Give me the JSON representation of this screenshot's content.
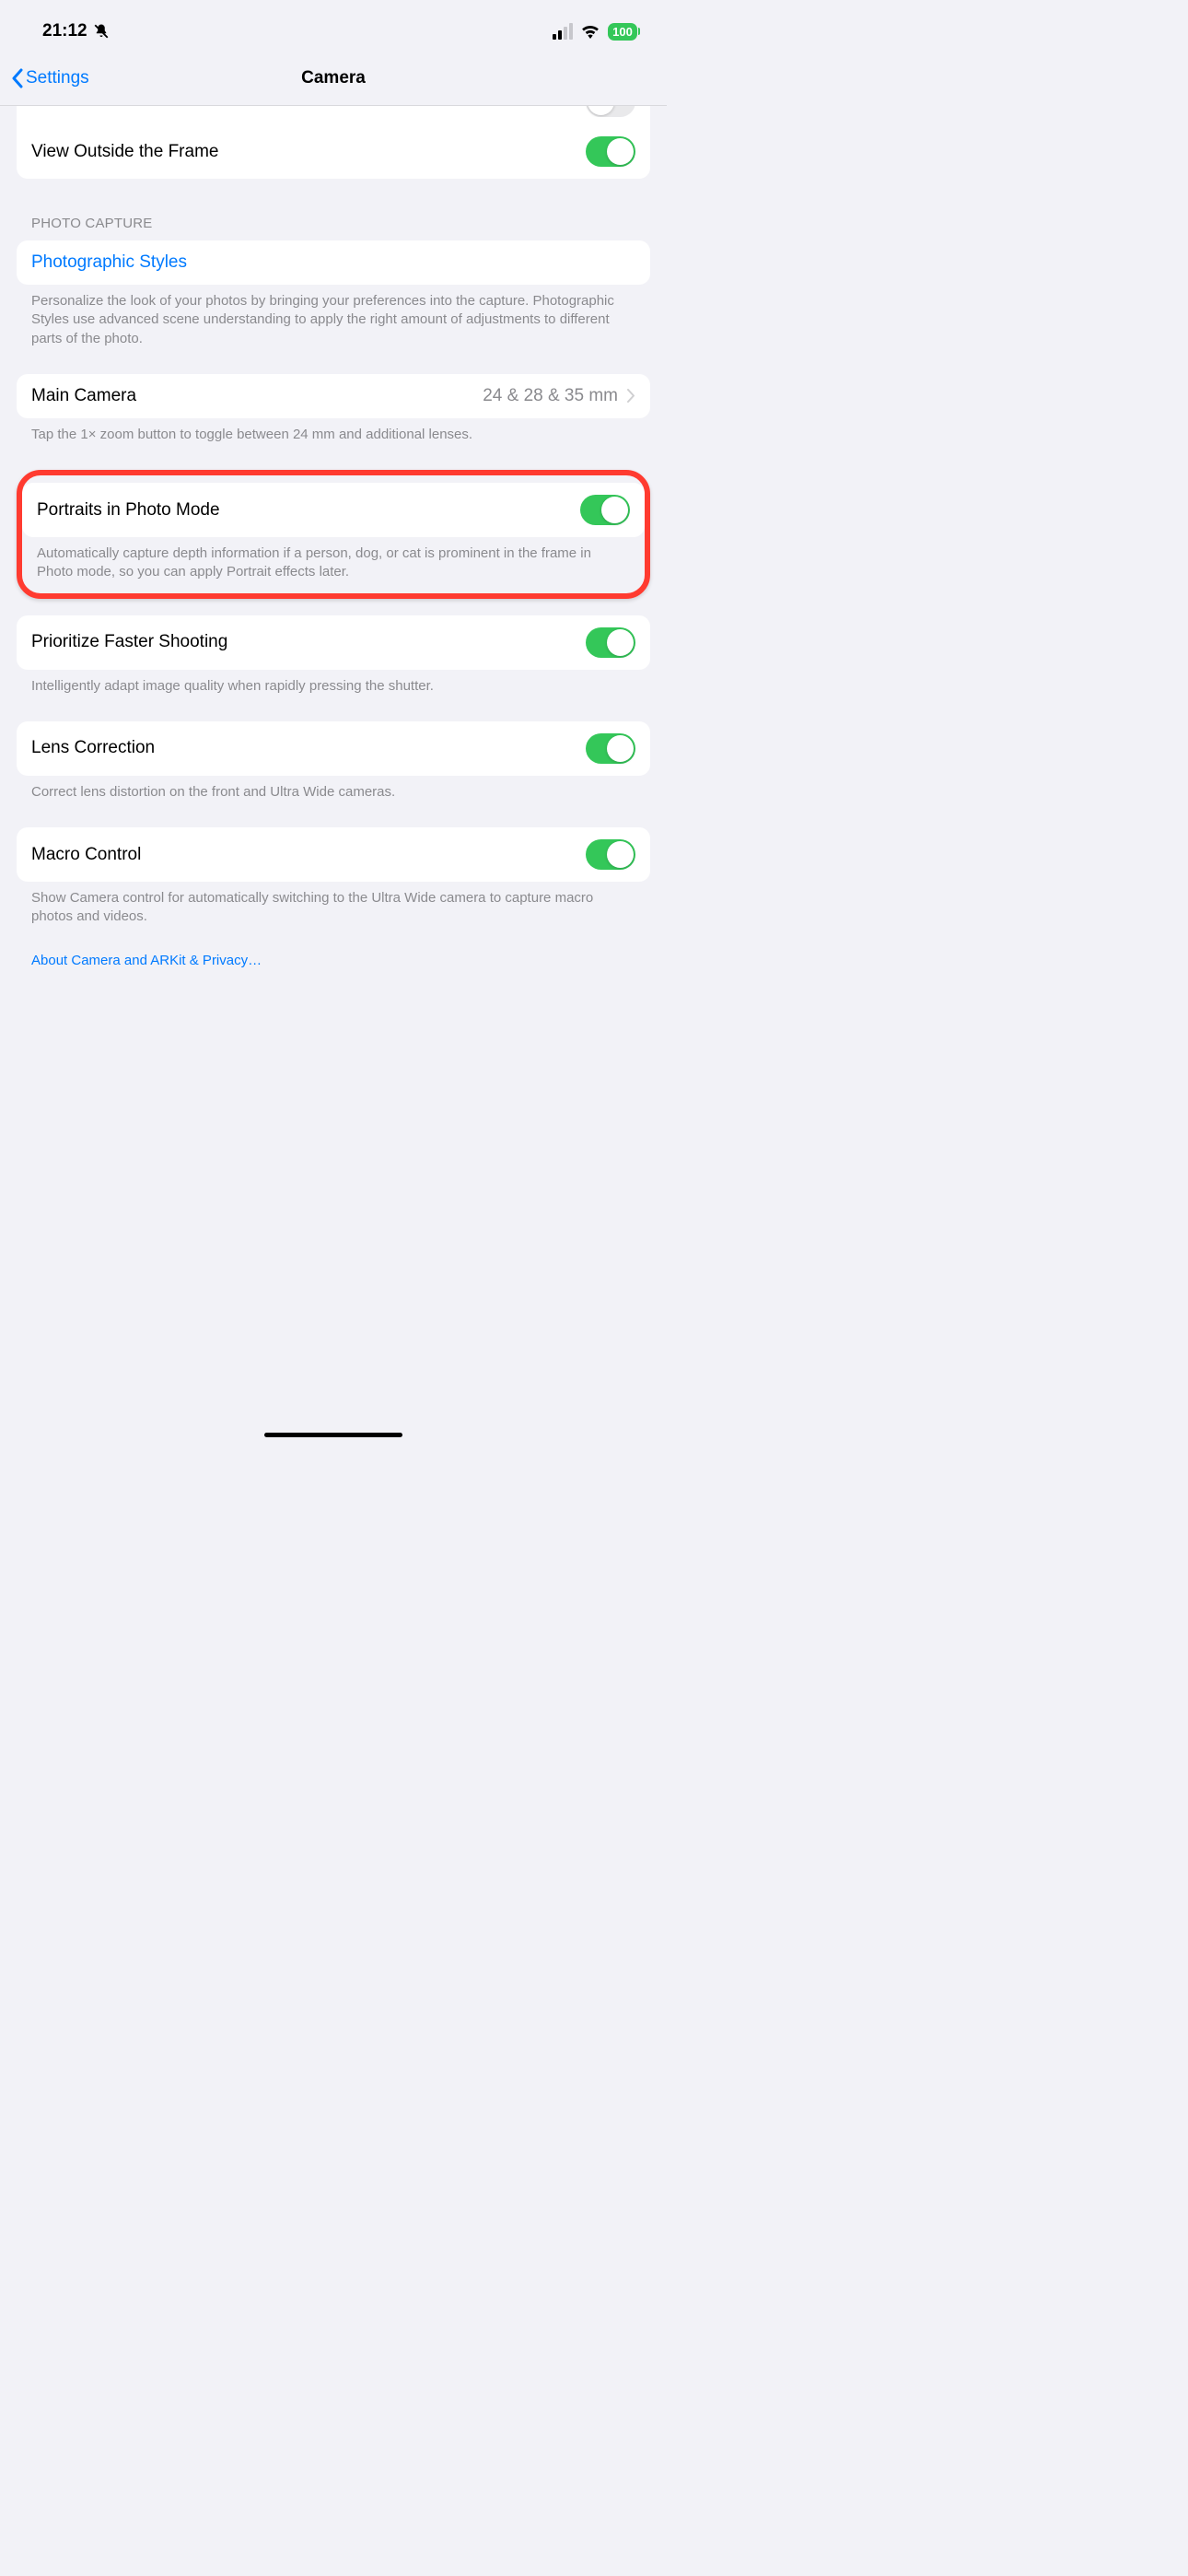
{
  "statusBar": {
    "time": "21:12",
    "battery": "100"
  },
  "nav": {
    "back": "Settings",
    "title": "Camera"
  },
  "rows": {
    "viewOutside": {
      "label": "View Outside the Frame"
    },
    "photographicStyles": {
      "label": "Photographic Styles"
    },
    "mainCamera": {
      "label": "Main Camera",
      "detail": "24 & 28 & 35 mm"
    },
    "portraits": {
      "label": "Portraits in Photo Mode"
    },
    "prioritize": {
      "label": "Prioritize Faster Shooting"
    },
    "lensCorrection": {
      "label": "Lens Correction"
    },
    "macroControl": {
      "label": "Macro Control"
    }
  },
  "sections": {
    "photoCapture": "PHOTO CAPTURE"
  },
  "footers": {
    "photographicStyles": "Personalize the look of your photos by bringing your preferences into the capture. Photographic Styles use advanced scene understanding to apply the right amount of adjustments to different parts of the photo.",
    "mainCamera": "Tap the 1× zoom button to toggle between 24 mm and additional lenses.",
    "portraits": "Automatically capture depth information if a person, dog, or cat is prominent in the frame in Photo mode, so you can apply Portrait effects later.",
    "prioritize": "Intelligently adapt image quality when rapidly pressing the shutter.",
    "lensCorrection": "Correct lens distortion on the front and Ultra Wide cameras.",
    "macroControl": "Show Camera control for automatically switching to the Ultra Wide camera to capture macro photos and videos."
  },
  "links": {
    "privacy": "About Camera and ARKit & Privacy…"
  }
}
